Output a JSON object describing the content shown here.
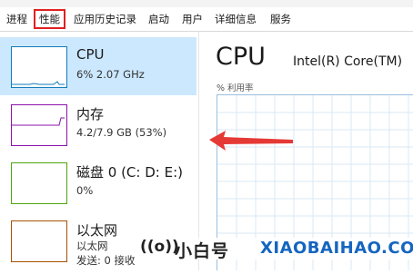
{
  "tabs": [
    {
      "label": "进程"
    },
    {
      "label": "性能",
      "active": true
    },
    {
      "label": "应用历史记录"
    },
    {
      "label": "启动"
    },
    {
      "label": "用户"
    },
    {
      "label": "详细信息"
    },
    {
      "label": "服务"
    }
  ],
  "sidebar": {
    "items": [
      {
        "title": "CPU",
        "sub": "6% 2.07 GHz",
        "selected": true,
        "color": "#117dbb"
      },
      {
        "title": "内存",
        "sub": "4.2/7.9 GB (53%)",
        "color": "#8b12ae"
      },
      {
        "title": "磁盘 0 (C: D: E:)",
        "sub": "0%",
        "color": "#4da60c"
      },
      {
        "title": "以太网",
        "sub": "以太网",
        "sub2": "发送: 0 接收",
        "color": "#a74f01"
      }
    ]
  },
  "main": {
    "title": "CPU",
    "processor": "Intel(R) Core(TM)",
    "util_label": "% 利用率"
  },
  "annotation": {
    "arrow_color": "#e53935",
    "tab_highlight_color": "#e02020"
  },
  "watermark": {
    "icon": "((o))",
    "brand": "小白号",
    "url": "XIAOBAIHAO.COM"
  },
  "colors": {
    "selected_bg": "#cce8ff",
    "graph_border": "#9ac0e0",
    "url_blue": "#1565c0"
  }
}
